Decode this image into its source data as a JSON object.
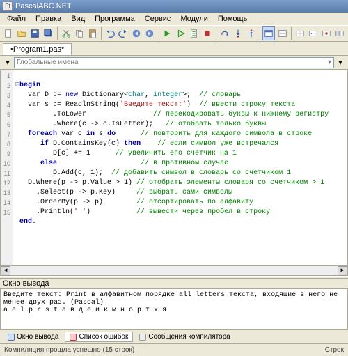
{
  "title": "PascalABC.NET",
  "menus": [
    "Файл",
    "Правка",
    "Вид",
    "Программа",
    "Сервис",
    "Модули",
    "Помощь"
  ],
  "tab": "•Program1.pas*",
  "nav": {
    "label": "Глобальные имена"
  },
  "gutter": [
    "1",
    "2",
    "3",
    "4",
    "5",
    "6",
    "7",
    "8",
    "9",
    "10",
    "11",
    "12",
    "13",
    "14",
    "15"
  ],
  "code": {
    "l1": {
      "kw": "begin"
    },
    "l2": {
      "a": "   var D := ",
      "b": "new",
      "c": " Dictionary<",
      "t1": "char",
      "d": ", ",
      "t2": "integer",
      "e": ">;  ",
      "cm": "// словарь"
    },
    "l3": {
      "a": "   var s := ReadlnString(",
      "s": "'Введите текст:'",
      "b": ")  ",
      "cm": "// ввести строку текста"
    },
    "l4": {
      "a": "         .ToLower                ",
      "cm": "// перекодировать буквы к нижнему регистру"
    },
    "l5": {
      "a": "         .Where(c -> c.IsLetter);   ",
      "cm": "// отобрать только буквы"
    },
    "l6": {
      "kw": "foreach",
      "a": " var c ",
      "kw2": "in",
      "b": " s ",
      "kw3": "do",
      "c": "      ",
      "cm": "// повторить для каждого символа в строке"
    },
    "l7": {
      "a": "      ",
      "kw": "if",
      "b": " D.ContainsKey(c) ",
      "kw2": "then",
      "c": "    ",
      "cm": "// если символ уже встречался"
    },
    "l8": {
      "a": "         D[c] += 1      ",
      "cm": "// увеличить его счетчик на 1"
    },
    "l9": {
      "a": "      ",
      "kw": "else",
      "b": "                    ",
      "cm": "// в противном случае"
    },
    "l10": {
      "a": "         D.Add(c, 1);  ",
      "cm": "// добавить символ в словарь со счетчиком 1"
    },
    "l11": {
      "a": "   D.Where(p -> p.Value > 1) ",
      "cm": "// отобрать элементы словаря со счетчиком > 1"
    },
    "l12": {
      "a": "     .Select(p -> p.Key)     ",
      "cm": "// выбрать сами символы"
    },
    "l13": {
      "a": "     .OrderBy(p -> p)        ",
      "cm": "// отсортировать по алфавиту"
    },
    "l14": {
      "a": "     .Println(",
      "s": "' '",
      "b": ")           ",
      "cm": "// вывести через пробел в строку"
    },
    "l15": {
      "kw": "end",
      "a": "."
    }
  },
  "output": {
    "title": "Окно вывода",
    "text": "Введите текст: Print в алфавитном порядке all letters текста, входящие в него не менее двух раз. (Pascal)\na e l p r s t а в д е и к м н о р т х я"
  },
  "bottomTabs": {
    "t1": "Окно вывода",
    "t2": "Список ошибок",
    "t3": "Сообщения компилятора"
  },
  "status": {
    "left": "Компиляция прошла успешно (15 строк)",
    "right": "Строк"
  }
}
